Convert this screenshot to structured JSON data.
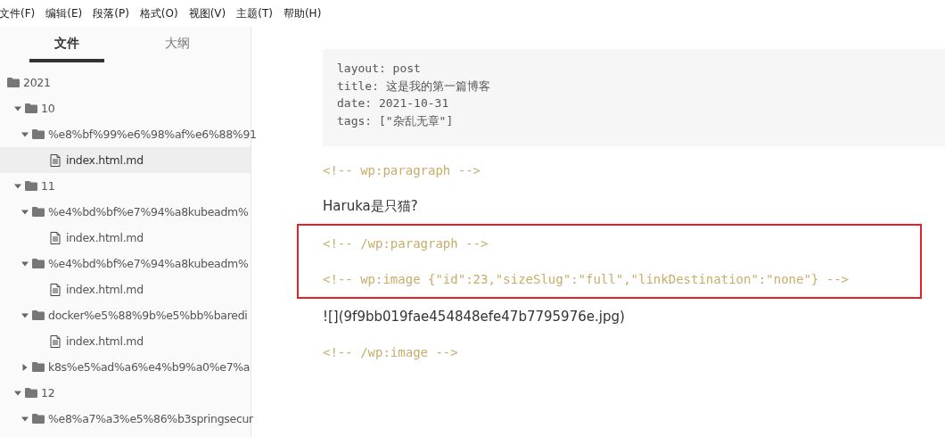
{
  "menu": [
    "文件(F)",
    "编辑(E)",
    "段落(P)",
    "格式(O)",
    "视图(V)",
    "主题(T)",
    "帮助(H)"
  ],
  "sidebar": {
    "tabs": [
      {
        "label": "文件",
        "selected": true
      },
      {
        "label": "大纲",
        "selected": false
      }
    ],
    "tree": [
      {
        "kind": "root",
        "name": "2021",
        "children": [
          {
            "kind": "folder",
            "name": "10",
            "expanded": true,
            "children": [
              {
                "kind": "folder",
                "name": "%e8%bf%99%e6%98%af%e6%88%91",
                "expanded": true,
                "children": [
                  {
                    "kind": "file",
                    "name": "index.html.md",
                    "selected": true
                  }
                ]
              }
            ]
          },
          {
            "kind": "folder",
            "name": "11",
            "expanded": true,
            "children": [
              {
                "kind": "folder",
                "name": "%e4%bd%bf%e7%94%a8kubeadm%",
                "expanded": true,
                "children": [
                  {
                    "kind": "file",
                    "name": "index.html.md",
                    "selected": false
                  }
                ]
              },
              {
                "kind": "folder",
                "name": "%e4%bd%bf%e7%94%a8kubeadm%",
                "expanded": true,
                "children": [
                  {
                    "kind": "file",
                    "name": "index.html.md",
                    "selected": false
                  }
                ]
              },
              {
                "kind": "folder",
                "name": "docker%e5%88%9b%e5%bb%baredi",
                "expanded": true,
                "children": [
                  {
                    "kind": "file",
                    "name": "index.html.md",
                    "selected": false
                  }
                ]
              },
              {
                "kind": "folder",
                "name": "k8s%e5%ad%a6%e4%b9%a0%e7%a",
                "expanded": false
              }
            ]
          },
          {
            "kind": "folder",
            "name": "12",
            "expanded": true,
            "children": [
              {
                "kind": "folder",
                "name": "%e8%a7%a3%e5%86%b3springsecur",
                "expanded": true
              }
            ]
          }
        ]
      }
    ]
  },
  "document": [
    {
      "kind": "frontmatter",
      "lines": [
        "layout: post",
        "title: 这是我的第一篇博客",
        "date: 2021-10-31",
        "tags: [\"杂乱无章\"]"
      ]
    },
    {
      "kind": "comment",
      "text": "<!-- wp:paragraph -->"
    },
    {
      "kind": "text",
      "text": "Haruka是只猫?"
    },
    {
      "kind": "annotation",
      "children": [
        {
          "kind": "comment",
          "text": "<!-- /wp:paragraph -->"
        },
        {
          "kind": "comment",
          "text": "<!-- wp:image {\"id\":23,\"sizeSlug\":\"full\",\"linkDestination\":\"none\"} -->"
        }
      ]
    },
    {
      "kind": "text",
      "text": "![](9f9bb019fae454848efe47b7795976e.jpg)"
    },
    {
      "kind": "comment",
      "text": "<!-- /wp:image -->"
    }
  ]
}
